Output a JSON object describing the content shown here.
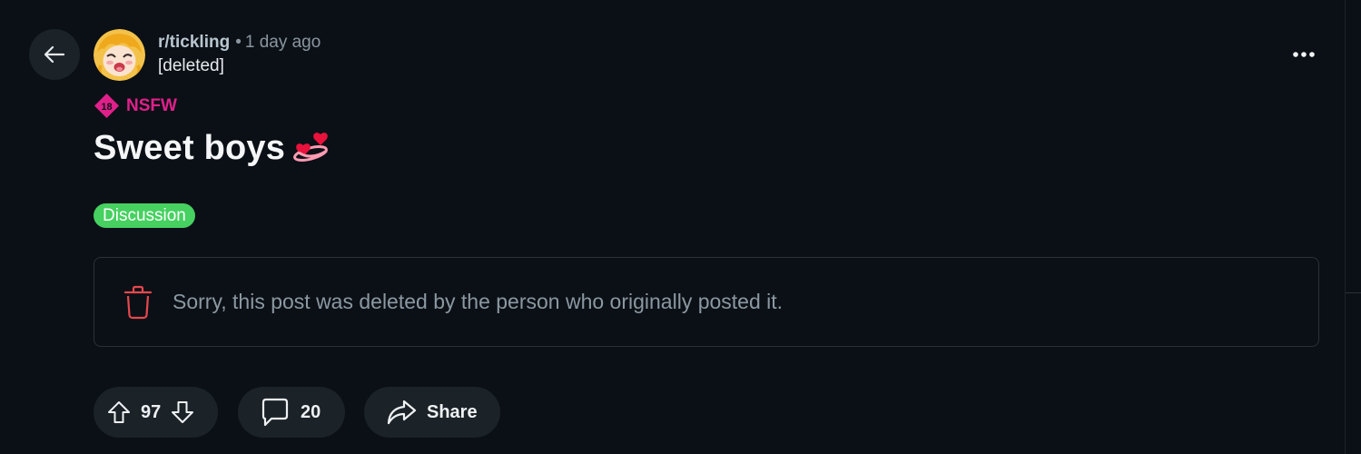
{
  "post": {
    "subreddit": "r/tickling",
    "separator": "•",
    "time": "1 day ago",
    "author": "[deleted]",
    "nsfw_badge": "18",
    "nsfw_label": "NSFW",
    "title": "Sweet boys",
    "title_emoji": "heart-on-fire-emoji",
    "flair": "Discussion",
    "deleted_message": "Sorry, this post was deleted by the person who originally posted it."
  },
  "actions": {
    "score": "97",
    "comments": "20",
    "share_label": "Share"
  },
  "colors": {
    "background": "#0b1016",
    "button_bg": "#1b2228",
    "nsfw": "#e0208a",
    "flair_bg": "#46d160",
    "trash": "#e5484d",
    "muted_text": "#8b98a1"
  },
  "icons": {
    "back": "arrow-left-icon",
    "more": "ellipsis-horizontal-icon",
    "nsfw": "nsfw-18-icon",
    "trash": "trash-icon",
    "upvote": "arrow-up-icon",
    "downvote": "arrow-down-icon",
    "comment": "comment-bubble-icon",
    "share": "share-arrow-icon"
  }
}
